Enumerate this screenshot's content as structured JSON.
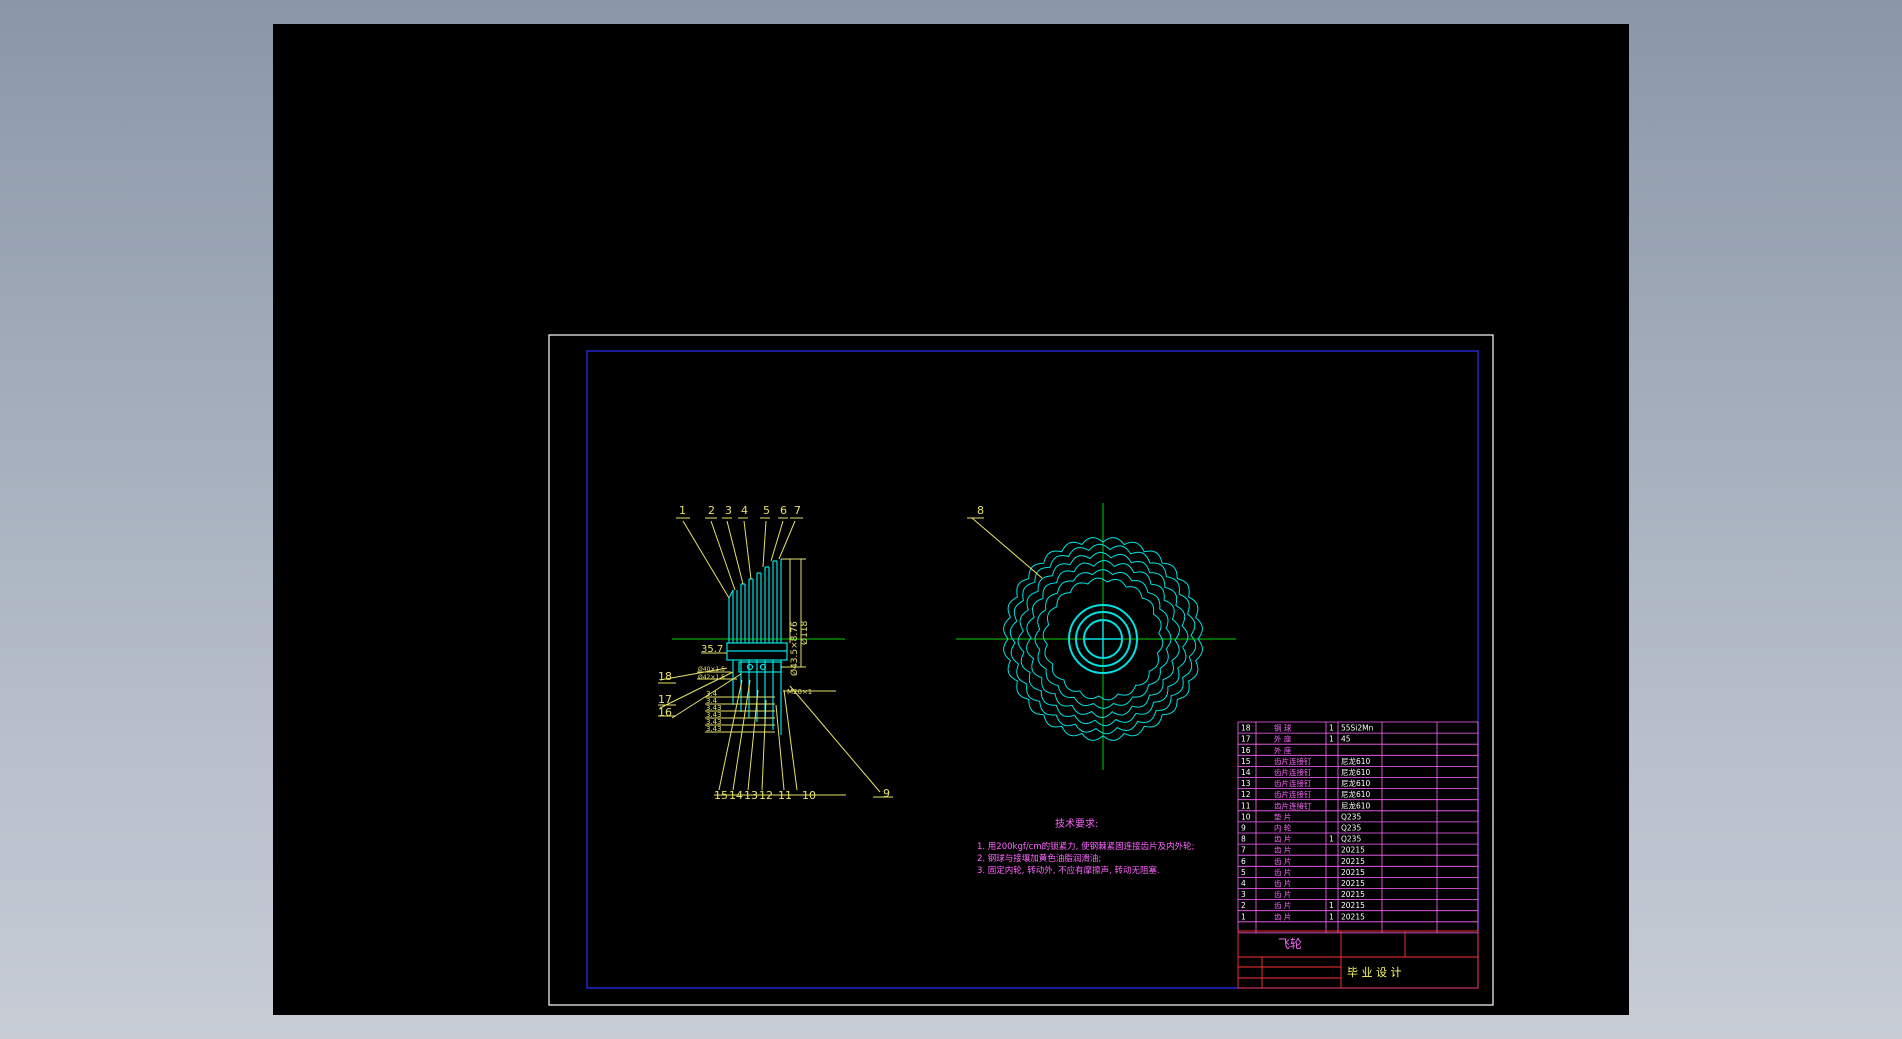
{
  "colors": {
    "background": "#000000",
    "frame_outer": "#ffffff",
    "frame_inner": "#2f2fff",
    "part_lines": "#00e0e0",
    "annotation": "#e6e26a",
    "center_lines": "#00d000",
    "tech_text": "#ff66ff",
    "title_block": "#ff66ff"
  },
  "side_view": {
    "callouts_top": [
      "1",
      "2",
      "3",
      "4",
      "5",
      "6",
      "7"
    ],
    "callouts_bottom": [
      "15",
      "14",
      "13",
      "12",
      "11",
      "10",
      "9"
    ],
    "callouts_left": [
      "18",
      "17",
      "16"
    ],
    "dimension_width": "35.7",
    "dimension_diameter": "Ø43.5×8.76",
    "dimension_overall": "Ø118",
    "dimension_thread": "M20×1",
    "small_dims": [
      "Ø40×1.5",
      "Ø42×1.5"
    ],
    "spacer_dims": [
      "3.4",
      "3.4",
      "3.43",
      "3.43",
      "3.43",
      "3.43"
    ]
  },
  "front_view": {
    "callout": "8"
  },
  "tech_requirements": {
    "title": "技术要求:",
    "items": [
      "1. 用200kgf/cm的锁紧力, 使钢棘紧固连接齿片及内外轮;",
      "2. 钢球与接壤加黄色油脂润滑油;",
      "3. 固定内轮, 转动外, 不应有摩擦声, 转动无阻塞."
    ]
  },
  "parts_list": {
    "rows": [
      {
        "no": "18",
        "name": "钢 球",
        "qty": "1",
        "material": "55Si2Mn"
      },
      {
        "no": "17",
        "name": "外 座",
        "qty": "1",
        "material": "45"
      },
      {
        "no": "16",
        "name": "外 座",
        "qty": "",
        "material": ""
      },
      {
        "no": "15",
        "name": "齿片连接钉",
        "qty": "",
        "material": "尼龙610"
      },
      {
        "no": "14",
        "name": "齿片连接钉",
        "qty": "",
        "material": "尼龙610"
      },
      {
        "no": "13",
        "name": "齿片连接钉",
        "qty": "",
        "material": "尼龙610"
      },
      {
        "no": "12",
        "name": "齿片连接钉",
        "qty": "",
        "material": "尼龙610"
      },
      {
        "no": "11",
        "name": "齿片连接钉",
        "qty": "",
        "material": "尼龙610"
      },
      {
        "no": "10",
        "name": "垫 片",
        "qty": "",
        "material": "Q235"
      },
      {
        "no": "9",
        "name": "内 轮",
        "qty": "",
        "material": "Q235"
      },
      {
        "no": "8",
        "name": "齿 片",
        "qty": "1",
        "material": "Q235"
      },
      {
        "no": "7",
        "name": "齿 片",
        "qty": "",
        "material": "20215"
      },
      {
        "no": "6",
        "name": "齿 片",
        "qty": "",
        "material": "20215"
      },
      {
        "no": "5",
        "name": "齿 片",
        "qty": "",
        "material": "20215"
      },
      {
        "no": "4",
        "name": "齿 片",
        "qty": "",
        "material": "20215"
      },
      {
        "no": "3",
        "name": "齿 片",
        "qty": "",
        "material": "20215"
      },
      {
        "no": "2",
        "name": "齿 片",
        "qty": "1",
        "material": "20215"
      },
      {
        "no": "1",
        "name": "齿 片",
        "qty": "1",
        "material": "20215"
      }
    ],
    "drawing_name": "飞轮",
    "title_block_label": "毕 业 设 计"
  }
}
